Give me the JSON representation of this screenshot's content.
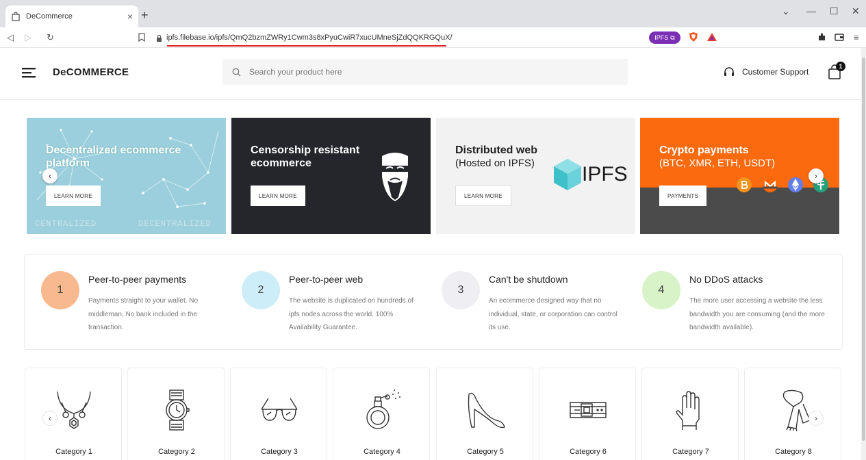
{
  "browser": {
    "tab_title": "DeCommerce",
    "tab_close": "×",
    "new_tab": "+",
    "url": "ipfs.filebase.io/ipfs/QmQ2bzmZWRy1Cwm3s8xPyuCwiR7xucUMneSjZdQQKRGQuX/",
    "ipfs_badge": "IPFS",
    "minimize": "—",
    "maximize": "☐",
    "close": "✕",
    "chevron": "⌄"
  },
  "header": {
    "brand": "DeCOMMERCE",
    "search_placeholder": "Search your product here",
    "support_label": "Customer Support",
    "cart_count": "1"
  },
  "banners": [
    {
      "title": "Decentralized ecommerce platform",
      "button": "LEARN MORE",
      "wm_left": "CENTRALIZED",
      "wm_right": "DECENTRALIZED"
    },
    {
      "title": "Censorship resistant ecommerce",
      "button": "LEARN MORE"
    },
    {
      "title": "Distributed web",
      "subtitle": "(Hosted on IPFS)",
      "logo_text": "IPFS",
      "button": "LEARN MORE"
    },
    {
      "title": "Crypto payments",
      "subtitle": "(BTC, XMR, ETH, USDT)",
      "button": "PAYMENTS"
    }
  ],
  "carousel": {
    "prev": "‹",
    "next": "›"
  },
  "features": [
    {
      "num": "1",
      "title": "Peer-to-peer payments",
      "desc": "Payments straight to your wallet. No middleman, No bank included in the transaction.",
      "color": "#f9b98e"
    },
    {
      "num": "2",
      "title": "Peer-to-peer web",
      "desc": "The website is duplicated on hundreds of ipfs nodes across the world. 100% Availability Guarantee.",
      "color": "#cdeef8"
    },
    {
      "num": "3",
      "title": "Can't be shutdown",
      "desc": "An ecommerce designed way that no individual, state, or corporation can control its use.",
      "color": "#efeef3"
    },
    {
      "num": "4",
      "title": "No DDoS attacks",
      "desc": "The more user accessing a website the less bandwidth you are consuming (and the more bandwidth available).",
      "color": "#d7f3c7"
    }
  ],
  "categories": [
    {
      "name": "Category 1",
      "icon": "necklace-icon"
    },
    {
      "name": "Category 2",
      "icon": "watch-icon"
    },
    {
      "name": "Category 3",
      "icon": "sunglasses-icon"
    },
    {
      "name": "Category 4",
      "icon": "perfume-icon"
    },
    {
      "name": "Category 5",
      "icon": "high-heel-icon"
    },
    {
      "name": "Category 6",
      "icon": "belt-icon"
    },
    {
      "name": "Category 7",
      "icon": "gloves-icon"
    },
    {
      "name": "Category 8",
      "icon": "scarf-icon"
    }
  ]
}
